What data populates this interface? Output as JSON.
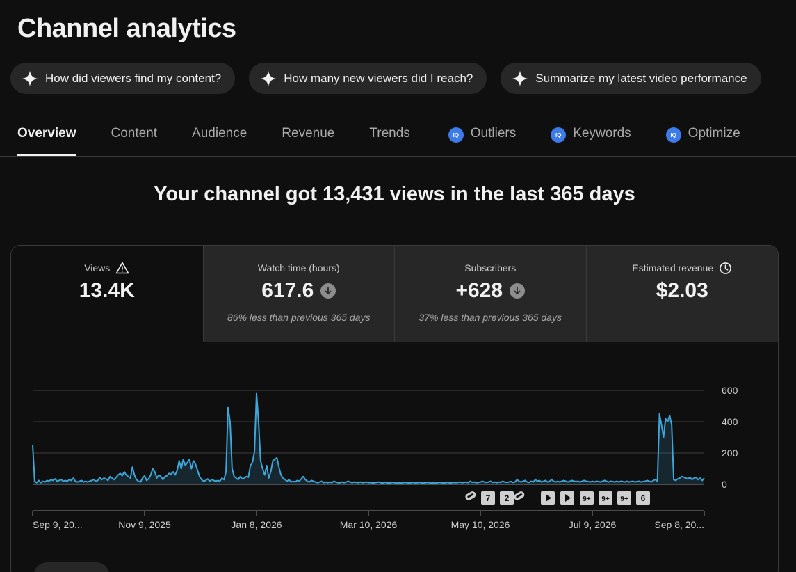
{
  "page_title": "Channel analytics",
  "chips": [
    {
      "label": "How did viewers find my content?",
      "icon": "sparkle-icon"
    },
    {
      "label": "How many new viewers did I reach?",
      "icon": "sparkle-icon"
    },
    {
      "label": "Summarize my latest video performance",
      "icon": "sparkle-icon"
    }
  ],
  "tabs": [
    {
      "label": "Overview",
      "active": true
    },
    {
      "label": "Content"
    },
    {
      "label": "Audience"
    },
    {
      "label": "Revenue"
    },
    {
      "label": "Trends"
    },
    {
      "label": "Outliers",
      "badge": "IQ"
    },
    {
      "label": "Keywords",
      "badge": "IQ"
    },
    {
      "label": "Optimize",
      "badge": "IQ"
    }
  ],
  "headline": "Your channel got 13,431 views in the last 365 days",
  "metrics": [
    {
      "label": "Views",
      "value": "13.4K",
      "icon": "warning-icon",
      "sub": ""
    },
    {
      "label": "Watch time (hours)",
      "value": "617.6",
      "icon": "arrow-down-icon",
      "sub": "86% less than previous 365 days"
    },
    {
      "label": "Subscribers",
      "value": "+628",
      "icon": "arrow-down-icon",
      "sub": "37% less than previous 365 days"
    },
    {
      "label": "Estimated revenue",
      "value": "$2.03",
      "icon": "clock-icon",
      "sub": ""
    }
  ],
  "colors": {
    "background": "#0f0f0f",
    "chip": "#272727",
    "accent_line": "#3ea6d8",
    "iq_badge": "#3d7bea"
  },
  "chart_data": {
    "type": "line",
    "series": [
      {
        "values": [
          250,
          20,
          10,
          25,
          10,
          20,
          15,
          25,
          20,
          30,
          25,
          35,
          20,
          25,
          30,
          20,
          25,
          20,
          30,
          25,
          40,
          20,
          15,
          20,
          25,
          15,
          20,
          15,
          20,
          25,
          30,
          20,
          25,
          45,
          30,
          40,
          35,
          25,
          50,
          40,
          30,
          45,
          60,
          70,
          55,
          80,
          60,
          50,
          40,
          110,
          60,
          30,
          20,
          15,
          40,
          55,
          25,
          35,
          60,
          100,
          80,
          40,
          60,
          50,
          30,
          50,
          55,
          70,
          65,
          80,
          60,
          90,
          150,
          100,
          160,
          120,
          140,
          160,
          100,
          150,
          130,
          90,
          50,
          30,
          20,
          25,
          35,
          20,
          30,
          25,
          20,
          25,
          20,
          40,
          30,
          80,
          490,
          400,
          100,
          50,
          40,
          30,
          50,
          35,
          40,
          50,
          45,
          120,
          140,
          210,
          580,
          400,
          150,
          100,
          60,
          120,
          40,
          80,
          150,
          160,
          170,
          110,
          60,
          40,
          30,
          20,
          30,
          15,
          20,
          15,
          25,
          20,
          35,
          50,
          30,
          20,
          15,
          25,
          20,
          15,
          10,
          15,
          20,
          10,
          15,
          10,
          15,
          10,
          20,
          15,
          10,
          10,
          15,
          10,
          15,
          20,
          15,
          10,
          15,
          12,
          10,
          15,
          10,
          12,
          15,
          10,
          12,
          8,
          10,
          12,
          15,
          10,
          8,
          12,
          10,
          8,
          10,
          12,
          10,
          8,
          10,
          8,
          10,
          12,
          10,
          8,
          10,
          12,
          8,
          10,
          12,
          10,
          8,
          10,
          12,
          10,
          8,
          10,
          8,
          10,
          12,
          10,
          8,
          10,
          12,
          8,
          10,
          12,
          10,
          12,
          15,
          10,
          12,
          15,
          10,
          20,
          12,
          15,
          10,
          12,
          15,
          20,
          15,
          12,
          15,
          20,
          12,
          15,
          10,
          15,
          12,
          20,
          15,
          12,
          15,
          18,
          12,
          15,
          30,
          20,
          15,
          20,
          25,
          15,
          12,
          20,
          15,
          30,
          20,
          25,
          15,
          20,
          25,
          15,
          20,
          30,
          20,
          15,
          20,
          15,
          20,
          25,
          20,
          15,
          20,
          25,
          20,
          18,
          20,
          15,
          20,
          25,
          20,
          18,
          15,
          20,
          15,
          20,
          18,
          15,
          20,
          25,
          20,
          15,
          20,
          18,
          15,
          20,
          15,
          20,
          18,
          15,
          20,
          15,
          18,
          20,
          15,
          18,
          20,
          15,
          18,
          20,
          25,
          20,
          15,
          25,
          30,
          20,
          450,
          380,
          300,
          420,
          400,
          440,
          380,
          30,
          25,
          35,
          40,
          50,
          45,
          40,
          35,
          45,
          30,
          40,
          45,
          30,
          40,
          25,
          40
        ],
        "color": "#3ea6d8"
      }
    ],
    "x_tick_labels": [
      "Sep 9, 20...",
      "Nov 9, 2025",
      "Jan 8, 2026",
      "Mar 10, 2026",
      "May 10, 2026",
      "Jul 9, 2026",
      "Sep 8, 20..."
    ],
    "y_tick_labels": [
      "600",
      "400",
      "200",
      "0"
    ],
    "ylim": [
      0,
      600
    ],
    "grid": true,
    "markers": [
      {
        "kind": "short",
        "label": ""
      },
      {
        "kind": "count",
        "label": "7"
      },
      {
        "kind": "count",
        "label": "2"
      },
      {
        "kind": "short",
        "label": ""
      },
      {
        "kind": "video",
        "label": ""
      },
      {
        "kind": "video",
        "label": ""
      },
      {
        "kind": "count",
        "label": "9+"
      },
      {
        "kind": "count",
        "label": "9+"
      },
      {
        "kind": "count",
        "label": "9+"
      },
      {
        "kind": "count",
        "label": "6"
      }
    ]
  }
}
